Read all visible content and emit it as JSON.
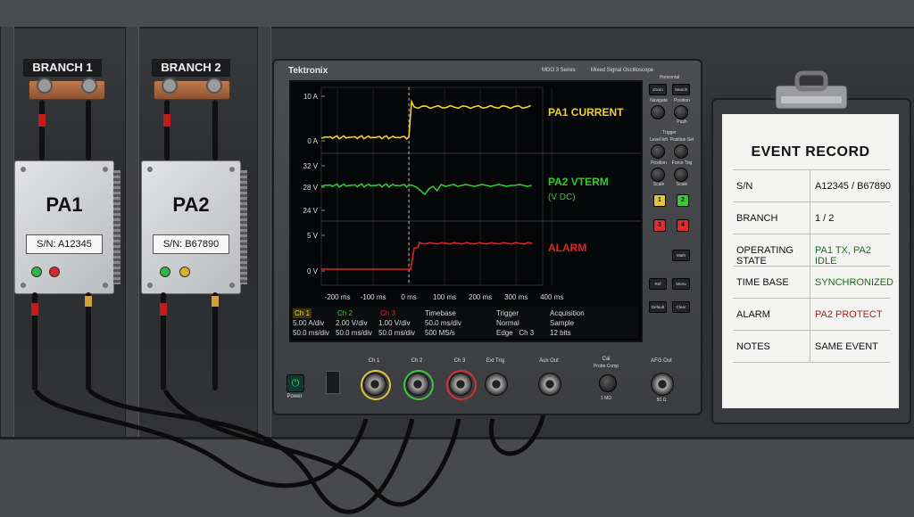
{
  "branches": [
    {
      "label": "BRANCH 1",
      "unit": "PA1",
      "sn": "S/N: A12345",
      "leds": [
        "#2fb34a",
        "#d42a2a"
      ]
    },
    {
      "label": "BRANCH 2",
      "unit": "PA2",
      "sn": "S/N: B67890",
      "leds": [
        "#2fb34a",
        "#d9b12a"
      ]
    }
  ],
  "scope": {
    "brand": "Tektronix",
    "series": "MDO 3 Series",
    "type": "Mixed Signal Oscilloscope",
    "traces": [
      {
        "name": "PA1 CURRENT",
        "color": "#f2d22e",
        "unit": "",
        "y_labels": [
          "10 A",
          "0 A"
        ]
      },
      {
        "name": "PA2 VTERM",
        "color": "#2ecc2e",
        "unit": "(V DC)",
        "y_labels": [
          "32 V",
          "28 V",
          "24 V"
        ]
      },
      {
        "name": "ALARM",
        "color": "#e02222",
        "unit": "",
        "y_labels": [
          "5 V",
          "0 V"
        ]
      }
    ],
    "x_labels": [
      "-200 ms",
      "-100 ms",
      "0 ms",
      "100 ms",
      "200 ms",
      "300 ms",
      "400 ms"
    ],
    "info": {
      "ch1": {
        "name": "Ch 1",
        "scale": "5.00 A/div",
        "time": "50.0 ms/div",
        "color": "#f2d22e"
      },
      "ch2": {
        "name": "Ch 2",
        "scale": "2.00 V/div",
        "time": "50.0 ms/div",
        "color": "#2ecc2e"
      },
      "ch3": {
        "name": "Ch 3",
        "scale": "1.00 V/div",
        "time": "50.0 ms/div",
        "color": "#e02222"
      },
      "timebase": {
        "title": "Timebase",
        "div": "50.0 ms/div",
        "rate": "500 MS/s"
      },
      "trigger": {
        "title": "Trigger",
        "mode": "Normal",
        "edge": "Edge",
        "source": "Ch 3"
      },
      "acquisition": {
        "title": "Acquisition",
        "mode": "Sample",
        "bits": "12 bits"
      }
    },
    "controls": {
      "horizontal": "Horizontal",
      "zoom": "Zoom",
      "search": "Search",
      "navigate": "Navigate",
      "position": "Position",
      "push": "Push",
      "trigger": "Trigger",
      "level_left": "Level left",
      "position_set": "Position Set",
      "position2": "Position",
      "scale": "Scale",
      "force_trig": "Force Trig",
      "scale2": "Scale",
      "math": "Math",
      "ref": "Ref",
      "menu": "Menu",
      "default": "Default",
      "clear": "Clear",
      "btn1": "1",
      "btn2": "2",
      "btn3": "3",
      "btn4": "4"
    },
    "front": {
      "power": "Power",
      "ch1": "Ch 1",
      "ch2": "Ch 2",
      "ch3": "Ch 3",
      "ext_trig": "Ext Trig",
      "aux_out": "Aux Out",
      "cal": "Cal",
      "cal_sub": "Probe Comp",
      "cal_r": "1 MΩ",
      "afg_out": "AFG Out",
      "afg_r": "50 Ω"
    }
  },
  "event_record": {
    "title": "EVENT RECORD",
    "rows": [
      {
        "key": "S/N",
        "value": "A12345 / B67890",
        "color": "#111111"
      },
      {
        "key": "BRANCH",
        "value": "1 / 2",
        "color": "#111111"
      },
      {
        "key": "OPERATING STATE",
        "value": "PA1 TX, PA2 IDLE",
        "color": "#1e6b1e"
      },
      {
        "key": "TIME BASE",
        "value": "SYNCHRONIZED",
        "color": "#1e6b1e"
      },
      {
        "key": "ALARM",
        "value": "PA2 PROTECT",
        "color": "#b01e1e"
      },
      {
        "key": "NOTES",
        "value": "SAME EVENT",
        "color": "#111111"
      }
    ]
  }
}
